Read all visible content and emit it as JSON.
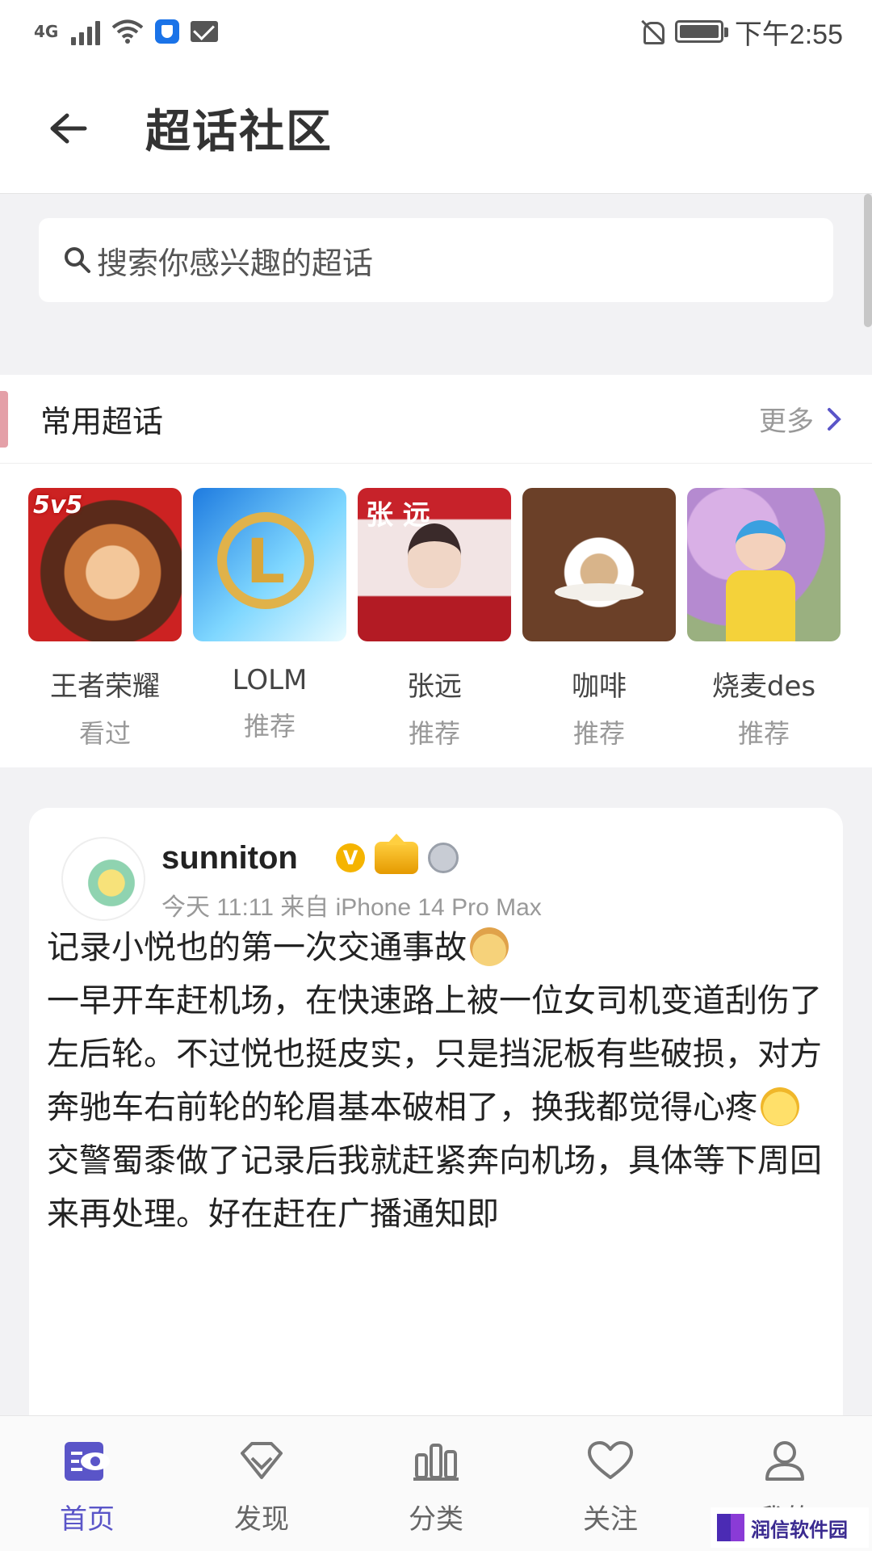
{
  "status_bar": {
    "network": "4G",
    "time": "下午2:55"
  },
  "header": {
    "title": "超话社区"
  },
  "search": {
    "placeholder": "搜索你感兴趣的超话"
  },
  "frequent": {
    "title": "常用超话",
    "more_label": "更多",
    "items": [
      {
        "name": "王者荣耀",
        "sub": "看过",
        "badge": "5v5"
      },
      {
        "name": "LOLM",
        "sub": "推荐",
        "badge": "L"
      },
      {
        "name": "张远",
        "sub": "推荐",
        "badge": "张 远"
      },
      {
        "name": "咖啡",
        "sub": "推荐"
      },
      {
        "name": "烧麦des",
        "sub": "推荐"
      }
    ]
  },
  "post": {
    "username": "sunniton",
    "meta": "今天 11:11  来自 iPhone 14 Pro Max",
    "paragraphs": [
      "记录小悦也的第一次交通事故",
      "一早开车赶机场，在快速路上被一位女司机变道刮伤了左后轮。不过悦也挺皮实，只是挡泥板有些破损，对方奔驰车右前轮的轮眉基本破相了，换我都觉得心疼",
      "交警蜀黍做了记录后我就赶紧奔向机场，具体等下周回来再处理。好在赶在广播通知即"
    ]
  },
  "tabbar": {
    "tabs": [
      {
        "label": "首页",
        "icon": "home-eye-icon",
        "active": true
      },
      {
        "label": "发现",
        "icon": "diamond-icon"
      },
      {
        "label": "分类",
        "icon": "bars-icon"
      },
      {
        "label": "关注",
        "icon": "heart-icon"
      },
      {
        "label": "我的",
        "icon": "person-icon"
      }
    ]
  },
  "watermark": {
    "text": "润信软件园"
  },
  "colors": {
    "accent": "#5a55c8",
    "section_marker": "#e4a0a8",
    "verified_badge": "#f5b400"
  }
}
